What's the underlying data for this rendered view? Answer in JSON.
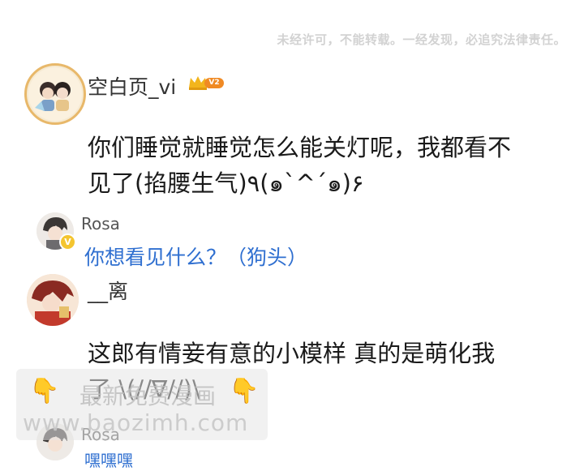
{
  "copyright_notice": "未经许可，不能转载。一经发现，必追究法律责任。",
  "comments": [
    {
      "username": "空白页_vi",
      "level_badge": "V2",
      "text_line1": "你们睡觉就睡觉怎么能关灯呢，我都看不",
      "text_line2": "见了(掐腰生气)٩(๑`^´๑)۶"
    },
    {
      "username": "__离",
      "text_line1": "这郎有情妾有意的小模样  真的是萌化我",
      "text_line2": "了 \\(//∇//)\\"
    }
  ],
  "replies": [
    {
      "username": "Rosa",
      "verified_badge": "V",
      "text": "你想看见什么？（狗头）"
    },
    {
      "username": "Rosa",
      "verified_badge": "V",
      "text": "嘿嘿嘿"
    }
  ],
  "watermark": {
    "line1": "最新免费漫画",
    "line2": "www.baozimh.com",
    "hand_icon": "👇"
  },
  "colors": {
    "reply_link": "#2f6fd0",
    "badge_gold": "#f4c530",
    "crown": "#f2b51c",
    "level_badge": "#f08a24"
  }
}
